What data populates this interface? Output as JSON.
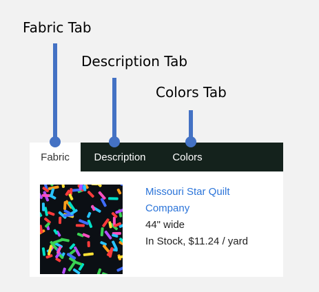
{
  "callouts": {
    "fabric": "Fabric Tab",
    "description": "Description Tab",
    "colors": "Colors Tab"
  },
  "tabs": {
    "fabric": "Fabric",
    "description": "Description",
    "colors": "Colors"
  },
  "product": {
    "name": "Missouri Star Quilt Company",
    "width": "44\" wide",
    "stock_price": "In Stock, $11.24 / yard"
  },
  "colors": {
    "callout": "#4472c4",
    "tabbar": "#14221c",
    "link": "#2b74d9"
  }
}
